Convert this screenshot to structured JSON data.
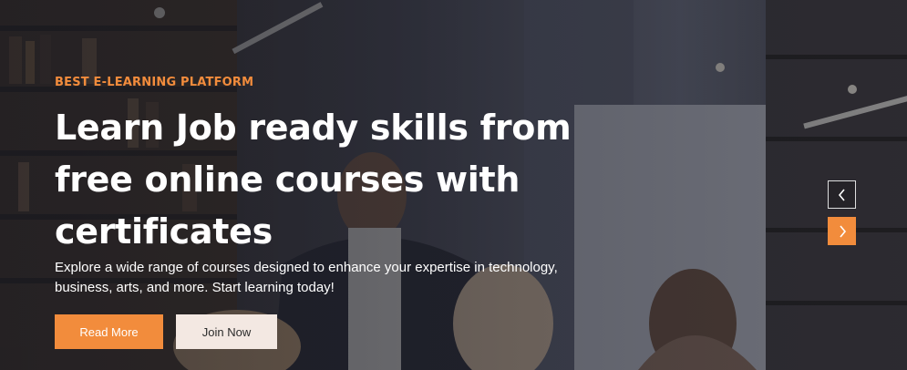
{
  "hero": {
    "subtitle": "BEST E-LEARNING PLATFORM",
    "headline": "Learn Job ready skills from free online courses with certificates",
    "description": "Explore a wide range of courses designed to enhance your expertise in technology, business, arts, and more. Start learning today!",
    "primary_button": "Read More",
    "secondary_button": "Join Now"
  },
  "slider": {
    "prev_icon": "chevron-left-icon",
    "next_icon": "chevron-right-icon"
  },
  "colors": {
    "accent": "#f28c3c",
    "secondary_button_bg": "#f3e8e2",
    "text_light": "#ffffff"
  }
}
